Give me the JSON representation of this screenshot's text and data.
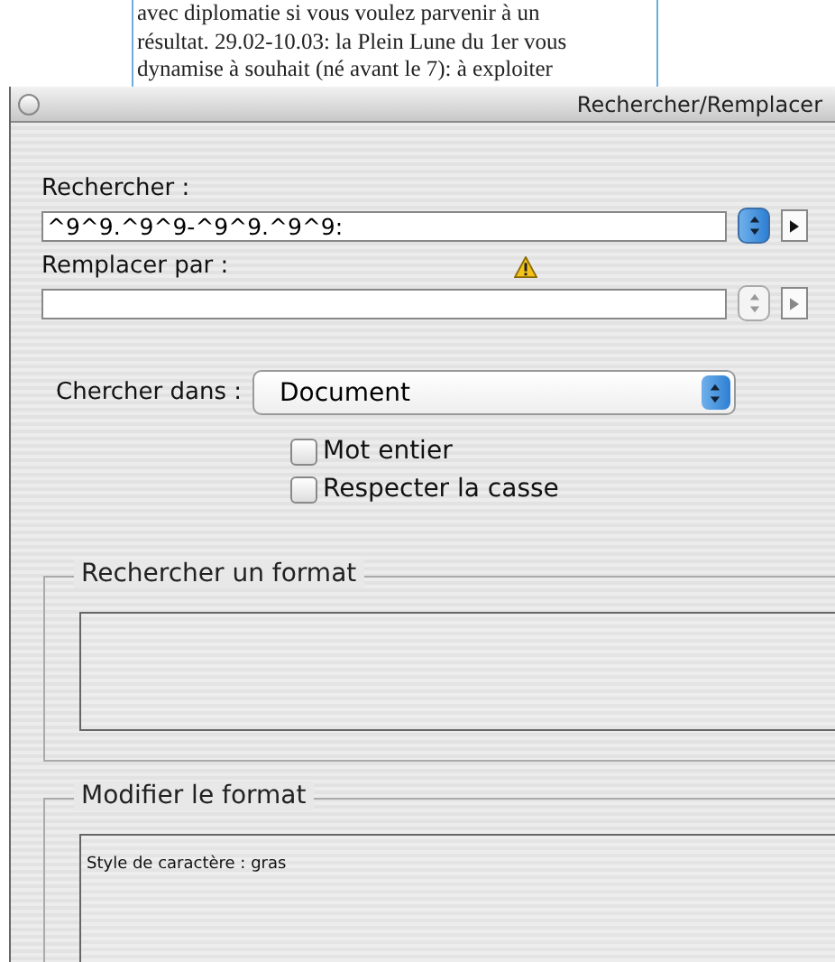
{
  "document": {
    "lines": [
      "avec diplomatie si vous voulez parvenir à un",
      "résultat. 29.02-10.03: la Plein Lune du 1er vous",
      "dynamise à souhait (né avant le 7): à exploiter"
    ]
  },
  "window": {
    "title": "Rechercher/Remplacer"
  },
  "find": {
    "label": "Rechercher :",
    "value": "^9^9.^9^9-^9^9.^9^9:",
    "active": true
  },
  "replace": {
    "label": "Remplacer par :",
    "active": false,
    "warning": true
  },
  "search_in": {
    "label": "Chercher dans :",
    "value": "Document"
  },
  "options": [
    {
      "label": "Mot entier",
      "checked": false
    },
    {
      "label": "Respecter la casse",
      "checked": false
    }
  ],
  "find_format": {
    "title": "Rechercher un format"
  },
  "change_format": {
    "title": "Modifier le format",
    "content": "Style de caractère : gras"
  }
}
